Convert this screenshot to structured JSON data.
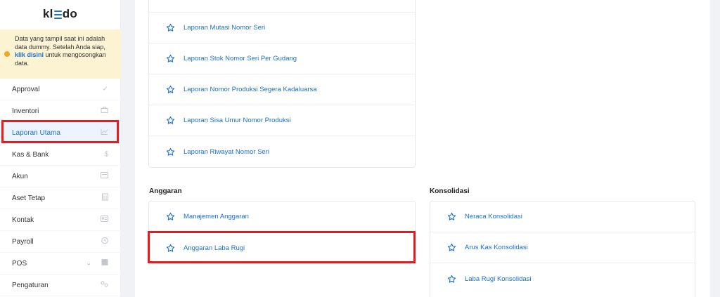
{
  "sidebar": {
    "logo": {
      "left": "kl",
      "right": "do"
    },
    "notice": {
      "text_before": "Data yang tampil saat ini adalah data dummy. Setelah Anda siap,",
      "link": "klik disini",
      "text_after": "untuk mengosongkan data."
    },
    "items": [
      {
        "label": "Approval",
        "icon": "check-icon"
      },
      {
        "label": "Inventori",
        "icon": "box-icon"
      },
      {
        "label": "Laporan Utama",
        "icon": "chart-icon",
        "active": true
      },
      {
        "label": "Kas & Bank",
        "icon": "dollar-icon"
      },
      {
        "label": "Akun",
        "icon": "card-icon"
      },
      {
        "label": "Aset Tetap",
        "icon": "building-icon"
      },
      {
        "label": "Kontak",
        "icon": "contact-icon"
      },
      {
        "label": "Payroll",
        "icon": "clock-icon"
      },
      {
        "label": "POS",
        "icon": "pos-icon"
      },
      {
        "label": "Pengaturan",
        "icon": "gear-icon"
      }
    ]
  },
  "main": {
    "top_card": {
      "items": [
        "Laporan Mutasi Nomor Seri",
        "Laporan Stok Nomor Seri Per Gudang",
        "Laporan Nomor Produksi Segera Kadaluarsa",
        "Laporan Sisa Umur Nomor Produksi",
        "Laporan Riwayat Nomor Seri"
      ]
    },
    "anggaran": {
      "title": "Anggaran",
      "items": [
        "Manajemen Anggaran",
        "Anggaran Laba Rugi"
      ]
    },
    "konsolidasi": {
      "title": "Konsolidasi",
      "items": [
        "Neraca Konsolidasi",
        "Arus Kas Konsolidasi",
        "Laba Rugi Konsolidasi"
      ]
    }
  },
  "colors": {
    "accent": "#1b6fd6",
    "highlight": "#e02020",
    "notice_bg": "#fcf3d3"
  }
}
